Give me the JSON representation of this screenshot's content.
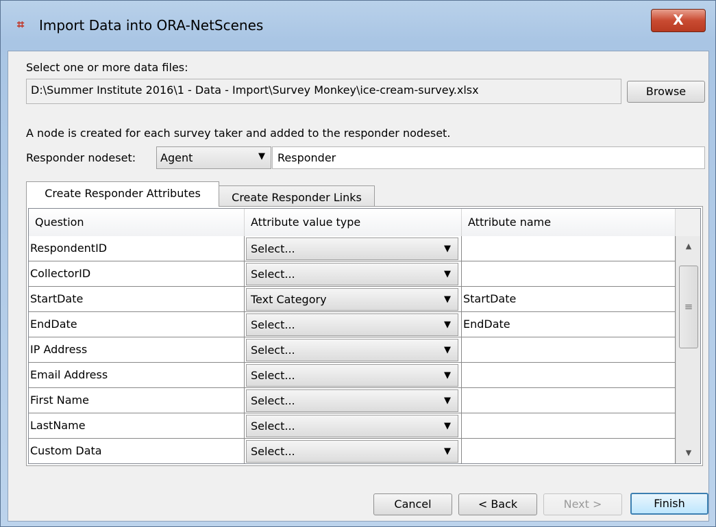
{
  "window": {
    "title": "Import Data into ORA-NetScenes",
    "app_icon": "ora-network-icon",
    "close_label": "X"
  },
  "file_section": {
    "label": "Select one or more data files:",
    "path": "D:\\Summer Institute 2016\\1 - Data - Import\\Survey Monkey\\ice-cream-survey.xlsx",
    "browse_label": "Browse"
  },
  "responder": {
    "info_text": "A node is created for each survey taker and added to the responder nodeset.",
    "nodeset_label": "Responder nodeset:",
    "nodeset_value": "Agent",
    "nodeset_name": "Responder"
  },
  "tabs": [
    {
      "label": "Create Responder Attributes",
      "active": true
    },
    {
      "label": "Create Responder Links",
      "active": false
    }
  ],
  "table": {
    "columns": [
      "Question",
      "Attribute value type",
      "Attribute name"
    ],
    "rows": [
      {
        "question": "RespondentID",
        "type": "Select...",
        "name": ""
      },
      {
        "question": "CollectorID",
        "type": "Select...",
        "name": ""
      },
      {
        "question": "StartDate",
        "type": "Text Category",
        "name": "StartDate"
      },
      {
        "question": "EndDate",
        "type": "Select...",
        "name": "EndDate"
      },
      {
        "question": "IP Address",
        "type": "Select...",
        "name": ""
      },
      {
        "question": "Email Address",
        "type": "Select...",
        "name": ""
      },
      {
        "question": "First Name",
        "type": "Select...",
        "name": ""
      },
      {
        "question": "LastName",
        "type": "Select...",
        "name": ""
      },
      {
        "question": "Custom Data",
        "type": "Select...",
        "name": ""
      }
    ]
  },
  "buttons": {
    "cancel": "Cancel",
    "back": "< Back",
    "next": "Next >",
    "finish": "Finish"
  }
}
